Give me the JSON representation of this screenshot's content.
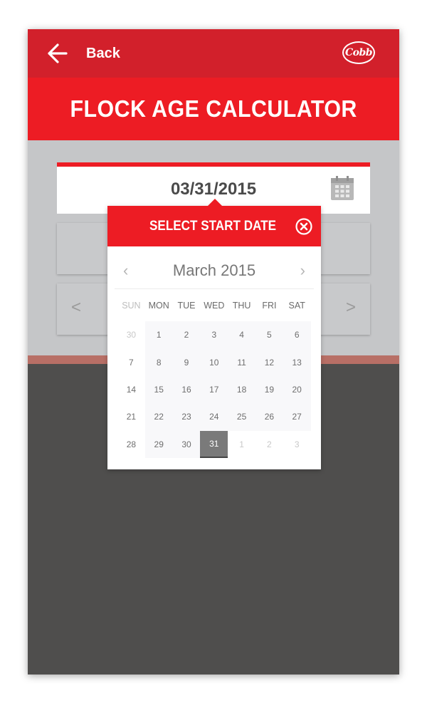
{
  "header": {
    "back_label": "Back",
    "logo_text": "Cobb",
    "title": "FLOCK AGE CALCULATOR"
  },
  "date_field": {
    "value": "03/31/2015"
  },
  "week_selector": {
    "prev_symbol": "<",
    "next_symbol": ">"
  },
  "date_picker": {
    "title": "SELECT START DATE",
    "month_label": "March 2015",
    "prev_symbol": "‹",
    "next_symbol": "›",
    "weekdays": [
      "SUN",
      "MON",
      "TUE",
      "WED",
      "THU",
      "FRI",
      "SAT"
    ],
    "weeks": [
      [
        "30",
        "1",
        "2",
        "3",
        "4",
        "5",
        "6"
      ],
      [
        "7",
        "8",
        "9",
        "10",
        "11",
        "12",
        "13"
      ],
      [
        "14",
        "15",
        "16",
        "17",
        "18",
        "19",
        "20"
      ],
      [
        "21",
        "22",
        "23",
        "24",
        "25",
        "26",
        "27"
      ],
      [
        "28",
        "29",
        "30",
        "31",
        "1",
        "2",
        "3"
      ]
    ],
    "selected_day": "31"
  },
  "colors": {
    "brand_red": "#ed1c24",
    "dark_red": "#d2202b",
    "background_dark": "#4f4e4d",
    "panel_gray": "#c5c6c8"
  },
  "icons": [
    "back-arrow-icon",
    "calendar-icon",
    "close-circle-icon",
    "chevron-left-icon",
    "chevron-right-icon"
  ]
}
